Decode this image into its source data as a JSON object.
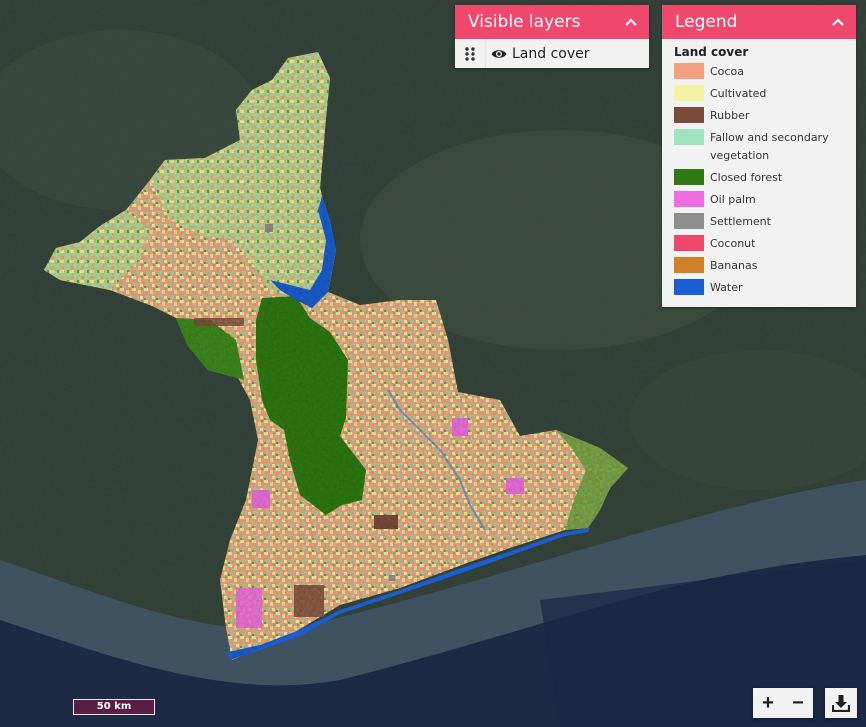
{
  "layers_panel": {
    "title": "Visible layers",
    "items": [
      {
        "label": "Land cover",
        "visible": true
      }
    ]
  },
  "legend": {
    "title": "Legend",
    "section_title": "Land cover",
    "items": [
      {
        "label": "Cocoa",
        "color": "#f2a07d"
      },
      {
        "label": "Cultivated",
        "color": "#f3f2a0"
      },
      {
        "label": "Rubber",
        "color": "#7d4b3a"
      },
      {
        "label": "Fallow and secondary vegetation",
        "color": "#9ee4c1"
      },
      {
        "label": "Closed forest",
        "color": "#2f7a12"
      },
      {
        "label": "Oil palm",
        "color": "#ee6ee0"
      },
      {
        "label": "Settlement",
        "color": "#8e8e8e"
      },
      {
        "label": "Coconut",
        "color": "#f0486d"
      },
      {
        "label": "Bananas",
        "color": "#d0802a"
      },
      {
        "label": "Water",
        "color": "#1a5ed1"
      }
    ]
  },
  "scale_bar": {
    "label": "50 km"
  },
  "controls": {
    "zoom_in": "+",
    "zoom_out": "−"
  },
  "colors": {
    "accent": "#f0486d",
    "panel_bg": "#f2f2f2",
    "sea": "#1c2a44",
    "land_satellite": "#34443a"
  }
}
